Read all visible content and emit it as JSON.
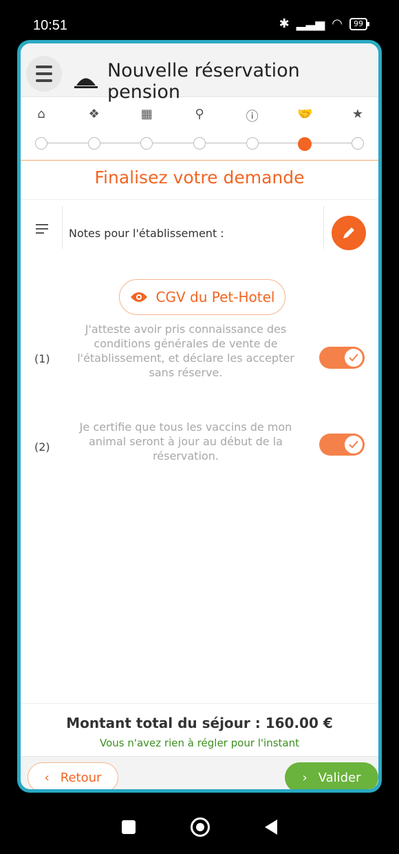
{
  "status_bar": {
    "time": "10:51",
    "battery": "99",
    "icons": [
      "bluetooth-icon",
      "signal-icon",
      "wifi-icon",
      "battery-icon"
    ]
  },
  "header": {
    "title": "Nouvelle réservation pension",
    "icon": "cloche-icon"
  },
  "stepper": {
    "steps": [
      {
        "icon": "house-icon",
        "glyph": "🏠"
      },
      {
        "icon": "paw-icon",
        "glyph": "🐾"
      },
      {
        "icon": "calendar-icon",
        "glyph": "📅"
      },
      {
        "icon": "search-icon",
        "glyph": "🔍"
      },
      {
        "icon": "info-icon",
        "glyph": "ℹ"
      },
      {
        "icon": "handshake-icon",
        "glyph": "🤝"
      },
      {
        "icon": "star-icon",
        "glyph": "★"
      }
    ],
    "active_index": 5
  },
  "main": {
    "section_title": "Finalisez votre demande",
    "notes_label": "Notes pour l'établissement :",
    "cgv_button": "CGV du Pet-Hotel",
    "conditions": [
      {
        "number": "(1)",
        "text": "J'atteste avoir pris connaissance des conditions générales de vente de l'établissement, et déclare les accepter sans réserve.",
        "checked": true
      },
      {
        "number": "(2)",
        "text": "Je certifie que tous les vaccins de mon animal seront à jour au début de la réservation.",
        "checked": true
      }
    ]
  },
  "summary": {
    "total": "Montant total du séjour : 160.00 €",
    "note": "Vous n'avez rien à régler pour l'instant"
  },
  "footer": {
    "back_label": "Retour",
    "validate_label": "Valider"
  },
  "colors": {
    "accent": "#f26522",
    "frame": "#2aa9c3",
    "success": "#6ab33c",
    "toggle": "#f5814a"
  }
}
